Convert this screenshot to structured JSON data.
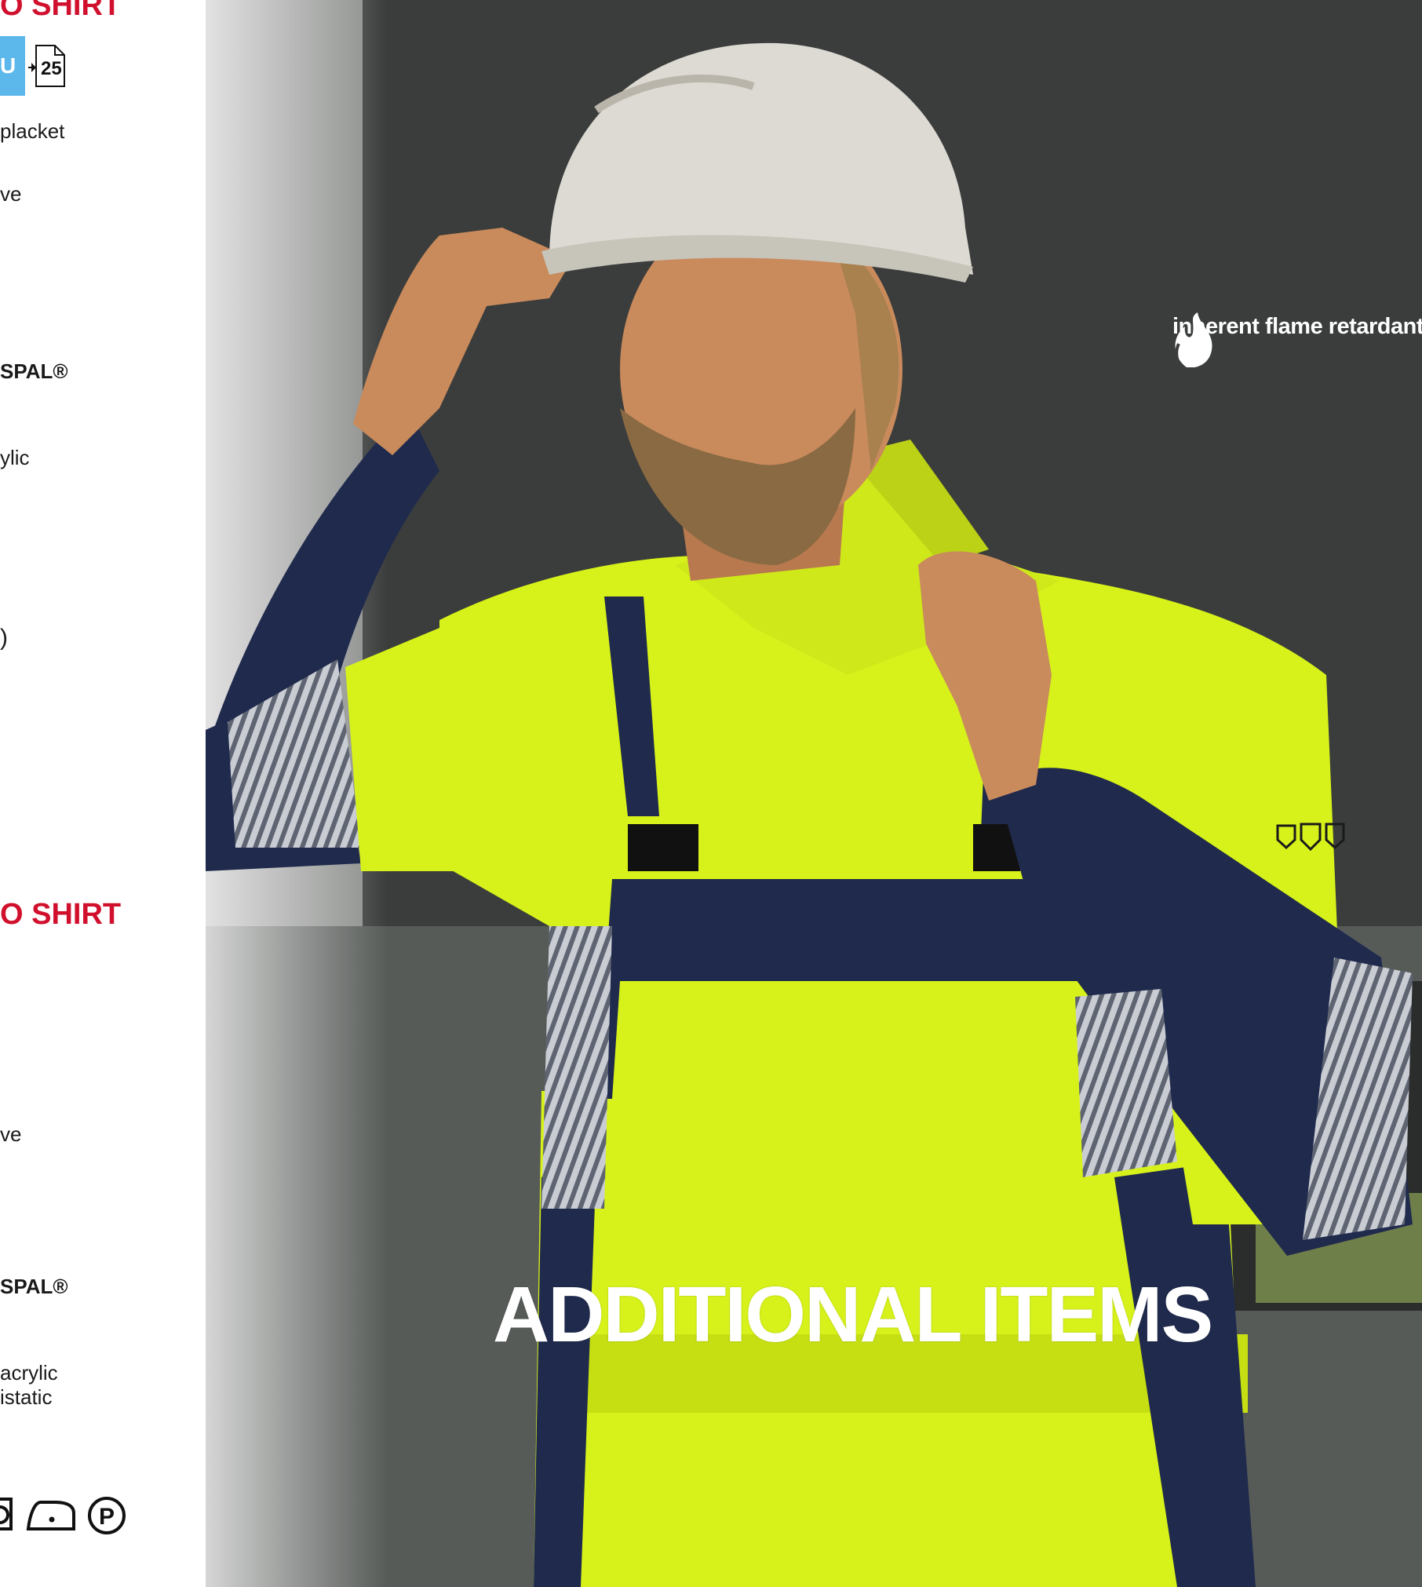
{
  "left_column": {
    "heading_top": "O SHIRT",
    "badge": "U",
    "page_ref": "25",
    "lines_1": [
      "placket",
      "ve"
    ],
    "brand_1": "SPAL®",
    "fabric_1": "ylic",
    "symbol_1": ")",
    "heading_2": "O SHIRT",
    "sleeve_2": "ve",
    "brand_2": "SPAL®",
    "fabric_2a": "acrylic",
    "fabric_2b": "istatic",
    "care_icons": [
      "wash-icon",
      "iron-icon",
      "dry-clean-p-icon"
    ]
  },
  "photo": {
    "flame_label": "inherent flame retardant",
    "headline": "ADDITIONAL ITEMS",
    "colors": {
      "hi_vis_yellow": "#d7f21a",
      "navy": "#1f2a4d",
      "helmet": "#dcdad2",
      "skin": "#c98a5c",
      "beard": "#8a6a42"
    }
  }
}
